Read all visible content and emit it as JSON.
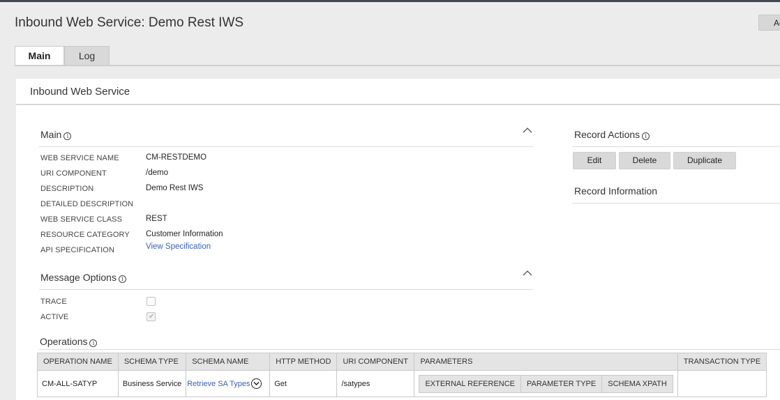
{
  "header": {
    "title": "Inbound Web Service: Demo Rest IWS",
    "action_button": "Ac"
  },
  "tabs": [
    {
      "label": "Main"
    },
    {
      "label": "Log"
    }
  ],
  "panel": {
    "title": "Inbound Web Service"
  },
  "main_section": {
    "title": "Main",
    "fields": [
      {
        "label": "WEB SERVICE NAME",
        "value": "CM-RESTDEMO"
      },
      {
        "label": "URI COMPONENT",
        "value": "/demo"
      },
      {
        "label": "DESCRIPTION",
        "value": "Demo Rest IWS"
      },
      {
        "label": "DETAILED DESCRIPTION",
        "value": ""
      },
      {
        "label": "WEB SERVICE CLASS",
        "value": "REST"
      },
      {
        "label": "RESOURCE CATEGORY",
        "value": "Customer Information"
      },
      {
        "label": "API SPECIFICATION",
        "value": "View Specification"
      }
    ]
  },
  "message_options": {
    "title": "Message Options",
    "trace_label": "TRACE",
    "trace_checked": false,
    "active_label": "ACTIVE",
    "active_checked": true
  },
  "record_actions": {
    "title": "Record Actions",
    "buttons": [
      "Edit",
      "Delete",
      "Duplicate"
    ]
  },
  "record_information": {
    "title": "Record Information"
  },
  "operations": {
    "title": "Operations",
    "columns": [
      "OPERATION NAME",
      "SCHEMA TYPE",
      "SCHEMA NAME",
      "HTTP METHOD",
      "URI COMPONENT",
      "PARAMETERS",
      "TRANSACTION TYPE"
    ],
    "rows": [
      {
        "operation_name": "CM-ALL-SATYP",
        "schema_type": "Business Service",
        "schema_name": "Retrieve SA Types",
        "http_method": "Get",
        "uri_component": "/satypes",
        "parameter_columns": [
          "EXTERNAL REFERENCE",
          "PARAMETER TYPE",
          "SCHEMA XPATH"
        ],
        "transaction_type": ""
      }
    ]
  },
  "icons": {
    "info": "info-circle-icon",
    "collapse": "chevron-up-icon",
    "expand_row": "chevron-down-circle-icon"
  },
  "colors": {
    "link": "#3b5fb6",
    "topbar": "#3f4a55"
  }
}
